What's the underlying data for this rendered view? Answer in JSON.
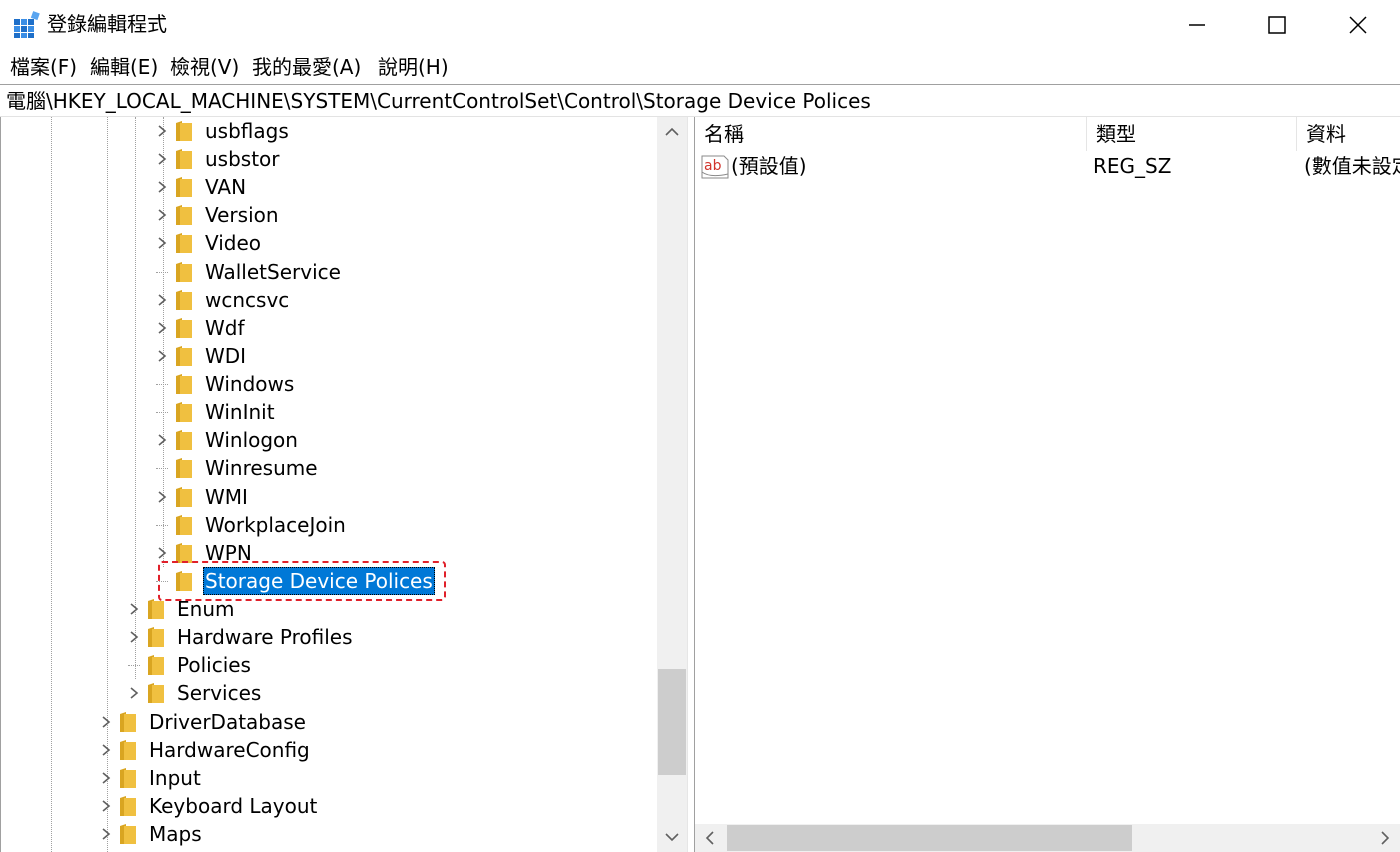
{
  "window": {
    "title": "登錄編輯程式",
    "icon": "registry-editor-icon",
    "controls": [
      "minimize-icon",
      "maximize-icon",
      "close-icon"
    ]
  },
  "menu": {
    "file": "檔案(F)",
    "edit": "編輯(E)",
    "view": "檢視(V)",
    "favorites": "我的最愛(A)",
    "help": "說明(H)"
  },
  "address": {
    "path": "電腦\\HKEY_LOCAL_MACHINE\\SYSTEM\\CurrentControlSet\\Control\\Storage Device Polices"
  },
  "tree": {
    "items": [
      {
        "label": "usbflags",
        "expandable": true
      },
      {
        "label": "usbstor",
        "expandable": true
      },
      {
        "label": "VAN",
        "expandable": true
      },
      {
        "label": "Version",
        "expandable": true
      },
      {
        "label": "Video",
        "expandable": true
      },
      {
        "label": "WalletService",
        "expandable": false
      },
      {
        "label": "wcncsvc",
        "expandable": true
      },
      {
        "label": "Wdf",
        "expandable": true
      },
      {
        "label": "WDI",
        "expandable": true
      },
      {
        "label": "Windows",
        "expandable": false
      },
      {
        "label": "WinInit",
        "expandable": false
      },
      {
        "label": "Winlogon",
        "expandable": true
      },
      {
        "label": "Winresume",
        "expandable": false
      },
      {
        "label": "WMI",
        "expandable": true
      },
      {
        "label": "WorkplaceJoin",
        "expandable": false
      },
      {
        "label": "WPN",
        "expandable": true
      },
      {
        "label": "Storage Device Polices",
        "expandable": false,
        "selected": true
      },
      {
        "label": "Enum",
        "expandable": true
      },
      {
        "label": "Hardware Profiles",
        "expandable": true
      },
      {
        "label": "Policies",
        "expandable": false
      },
      {
        "label": "Services",
        "expandable": true
      },
      {
        "label": "DriverDatabase",
        "expandable": true
      },
      {
        "label": "HardwareConfig",
        "expandable": true
      },
      {
        "label": "Input",
        "expandable": true
      },
      {
        "label": "Keyboard Layout",
        "expandable": true
      },
      {
        "label": "Maps",
        "expandable": true
      }
    ]
  },
  "list": {
    "columns": {
      "name": "名稱",
      "type": "類型",
      "data": "資料"
    },
    "rows": [
      {
        "name": "(預設值)",
        "type": "REG_SZ",
        "data": "(數值未設定)",
        "icon": "string-value-icon"
      }
    ]
  },
  "colors": {
    "selection": "#0078d7",
    "highlight_outline": "#e0202a",
    "folder": "#f0c040"
  }
}
